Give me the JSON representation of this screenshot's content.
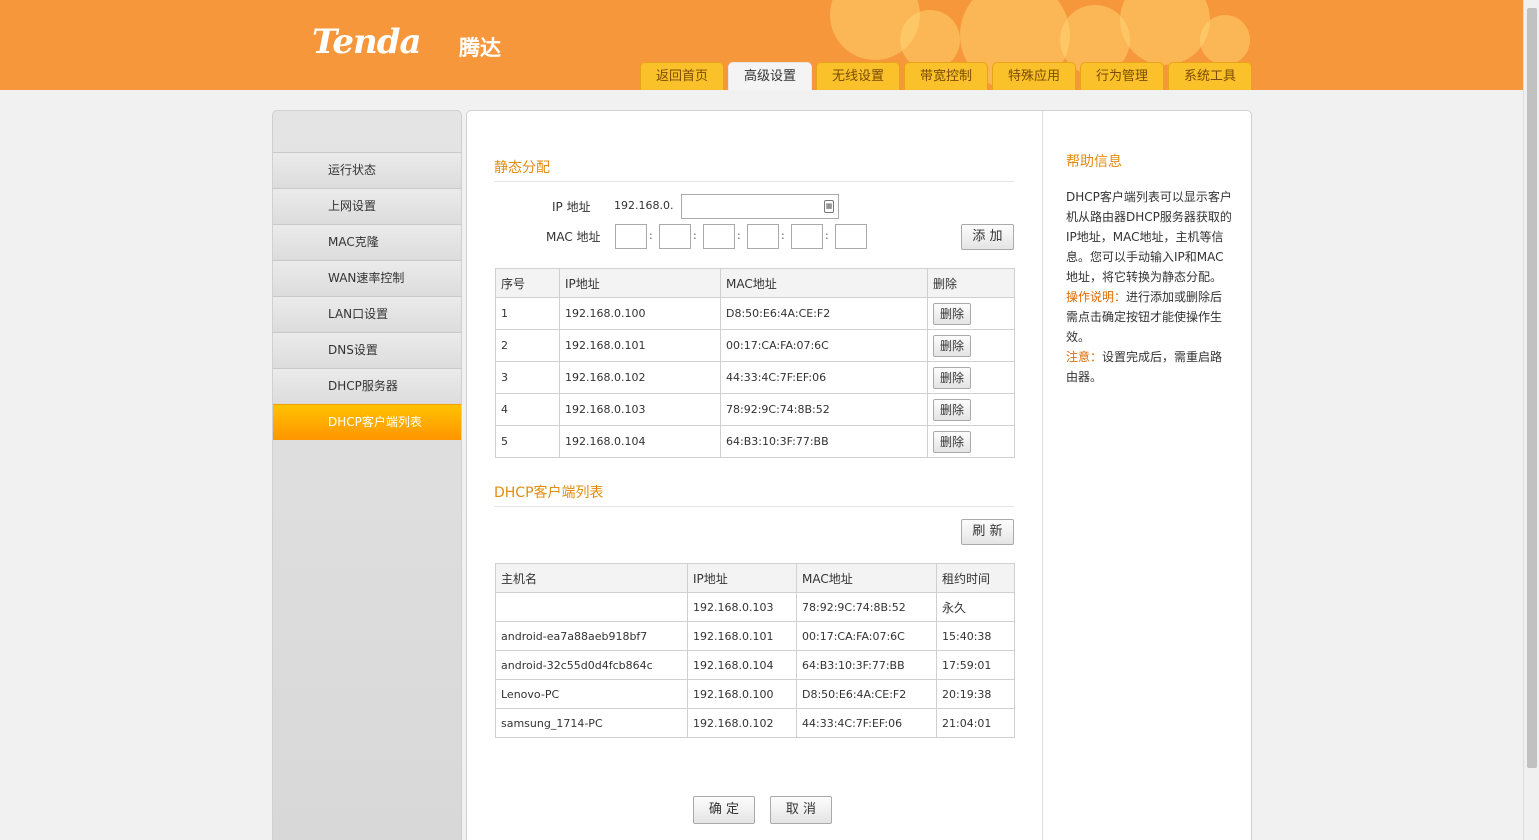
{
  "brand": {
    "logo": "Tenda",
    "logo_cn": "腾达"
  },
  "nav": {
    "tabs": [
      "返回首页",
      "高级设置",
      "无线设置",
      "带宽控制",
      "特殊应用",
      "行为管理",
      "系统工具"
    ],
    "active_index": 1
  },
  "sidebar": {
    "items": [
      "运行状态",
      "上网设置",
      "MAC克隆",
      "WAN速率控制",
      "LAN口设置",
      "DNS设置",
      "DHCP服务器",
      "DHCP客户端列表"
    ],
    "active_index": 7
  },
  "static": {
    "title": "静态分配",
    "ip_label": "IP 地址",
    "ip_prefix": "192.168.0.",
    "ip_value": "",
    "mac_label": "MAC 地址",
    "mac_values": [
      "",
      "",
      "",
      "",
      "",
      ""
    ],
    "add_label": "添 加",
    "headers": [
      "序号",
      "IP地址",
      "MAC地址",
      "删除"
    ],
    "delete_label": "删除",
    "rows": [
      [
        "1",
        "192.168.0.100",
        "D8:50:E6:4A:CE:F2"
      ],
      [
        "2",
        "192.168.0.101",
        "00:17:CA:FA:07:6C"
      ],
      [
        "3",
        "192.168.0.102",
        "44:33:4C:7F:EF:06"
      ],
      [
        "4",
        "192.168.0.103",
        "78:92:9C:74:8B:52"
      ],
      [
        "5",
        "192.168.0.104",
        "64:B3:10:3F:77:BB"
      ]
    ]
  },
  "clients": {
    "title": "DHCP客户端列表",
    "refresh_label": "刷 新",
    "headers": [
      "主机名",
      "IP地址",
      "MAC地址",
      "租约时间"
    ],
    "rows": [
      [
        "",
        "192.168.0.103",
        "78:92:9C:74:8B:52",
        "永久"
      ],
      [
        "android-ea7a88aeb918bf7",
        "192.168.0.101",
        "00:17:CA:FA:07:6C",
        "15:40:38"
      ],
      [
        "android-32c55d0d4fcb864c",
        "192.168.0.104",
        "64:B3:10:3F:77:BB",
        "17:59:01"
      ],
      [
        "Lenovo-PC",
        "192.168.0.100",
        "D8:50:E6:4A:CE:F2",
        "20:19:38"
      ],
      [
        "samsung_1714-PC",
        "192.168.0.102",
        "44:33:4C:7F:EF:06",
        "21:04:01"
      ]
    ]
  },
  "footer": {
    "ok_label": "确 定",
    "cancel_label": "取 消"
  },
  "help": {
    "title": "帮助信息",
    "intro": "DHCP客户端列表可以显示客户机从路由器DHCP服务器获取的IP地址，MAC地址，主机等信息。您可以手动输入IP和MAC地址，将它转换为静态分配。",
    "op_label": "操作说明：",
    "op_text": "进行添加或删除后需点击确定按钮才能使操作生效。",
    "note_label": "注意：",
    "note_text": "设置完成后，需重启路由器。"
  },
  "colors": {
    "header": "#f7973b",
    "tab": "#fbc12a",
    "accent": "#e28c10",
    "active_menu": "#ff9500"
  }
}
